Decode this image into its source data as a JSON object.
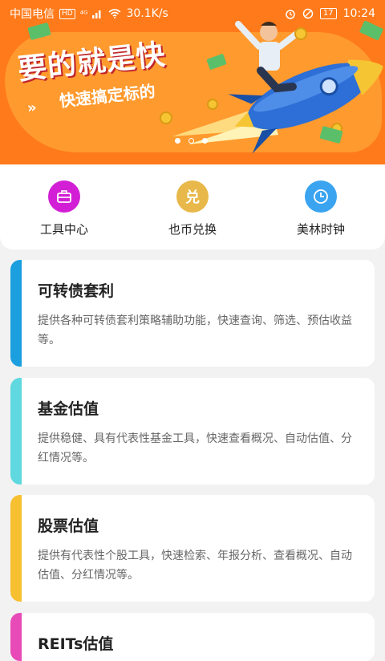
{
  "status_bar": {
    "carrier": "中国电信",
    "hd_badge": "HD",
    "network": "⁴ᴳ",
    "speed": "30.1K/s",
    "battery": "17",
    "time": "10:24"
  },
  "banner": {
    "headline": "要的就是快",
    "subline": "快速搞定标的",
    "chevrons": "»"
  },
  "quick_links": [
    {
      "label": "工具中心",
      "color": "#d21fd6",
      "icon": "toolbox-icon"
    },
    {
      "label": "也币兑换",
      "color": "#e8b84a",
      "icon": "exchange-icon",
      "glyph": "兑"
    },
    {
      "label": "美林时钟",
      "color": "#3aa4f0",
      "icon": "clock-icon"
    }
  ],
  "cards": [
    {
      "title": "可转债套利",
      "desc": "提供各种可转债套利策略辅助功能，快速查询、筛选、预估收益等。",
      "accent": "#1b9fde"
    },
    {
      "title": "基金估值",
      "desc": "提供稳健、具有代表性基金工具，快速查看概况、自动估值、分红情况等。",
      "accent": "#5fd8e0"
    },
    {
      "title": "股票估值",
      "desc": "提供有代表性个股工具，快速检索、年报分析、查看概况、自动估值、分红情况等。",
      "accent": "#f7c030"
    },
    {
      "title": "REITs估值",
      "desc": "",
      "accent": "#e84ab8"
    }
  ]
}
